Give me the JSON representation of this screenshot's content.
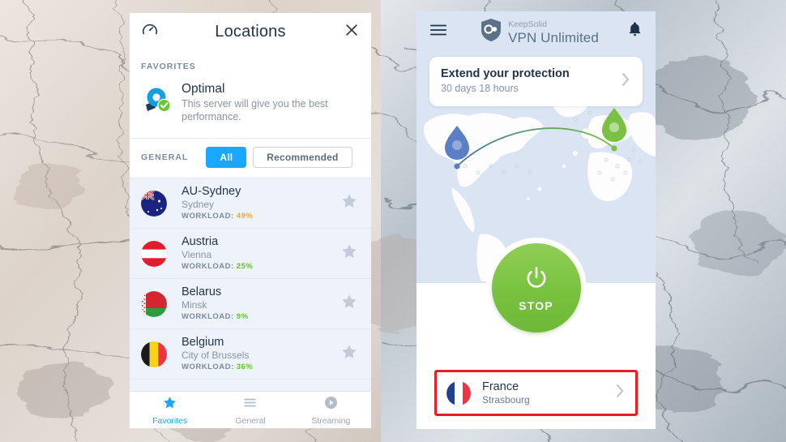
{
  "background": {
    "description": "marble-stone-texture",
    "left_tone": "#ded5cd",
    "right_tone": "#c3cbd3"
  },
  "locations_panel": {
    "header": {
      "gauge_icon": "speedometer-icon",
      "title": "Locations",
      "close_icon": "close-icon"
    },
    "favorites": {
      "label": "FAVORITES",
      "optimal": {
        "icon": "optimal-server-pin-icon",
        "name": "Optimal",
        "description": "This server will give you the best performance."
      }
    },
    "general": {
      "label": "GENERAL",
      "filters": [
        {
          "label": "All",
          "active": true
        },
        {
          "label": "Recommended",
          "active": false
        }
      ]
    },
    "servers": [
      {
        "name": "AU-Sydney",
        "city": "Sydney",
        "workload_label": "WORKLOAD:",
        "workload": "49%",
        "workload_color": "#f0a830",
        "flag": "flag-australia",
        "starred": false
      },
      {
        "name": "Austria",
        "city": "Vienna",
        "workload_label": "WORKLOAD:",
        "workload": "25%",
        "workload_color": "#64c832",
        "flag": "flag-austria",
        "starred": false
      },
      {
        "name": "Belarus",
        "city": "Minsk",
        "workload_label": "WORKLOAD:",
        "workload": "9%",
        "workload_color": "#64c832",
        "flag": "flag-belarus",
        "starred": false
      },
      {
        "name": "Belgium",
        "city": "City of Brussels",
        "workload_label": "WORKLOAD:",
        "workload": "36%",
        "workload_color": "#64c832",
        "flag": "flag-belgium",
        "starred": false
      }
    ],
    "tabs": [
      {
        "label": "Favorites",
        "icon": "star-icon",
        "active": true
      },
      {
        "label": "General",
        "icon": "list-icon",
        "active": false
      },
      {
        "label": "Streaming",
        "icon": "play-circle-icon",
        "active": false
      }
    ]
  },
  "vpn_panel": {
    "header": {
      "menu_icon": "hamburger-menu-icon",
      "logo_icon": "keepsolid-shield-logo-icon",
      "brand_top": "KeepSolid",
      "brand_main": "VPN Unlimited",
      "bell_icon": "notification-bell-icon"
    },
    "extend_card": {
      "title": "Extend your protection",
      "subtitle": "30 days 18 hours",
      "chevron_icon": "chevron-right-icon"
    },
    "map": {
      "origin_pin": "blue-location-pin",
      "destination_pin": "green-location-pin",
      "origin_color": "#5b7fc4",
      "destination_color": "#7ac143"
    },
    "power_button": {
      "label": "STOP",
      "icon": "power-icon",
      "color": "#78c23f"
    },
    "location_selector": {
      "country": "France",
      "city": "Strasbourg",
      "flag": "flag-france",
      "chevron_icon": "chevron-right-icon",
      "highlight_color": "#ec1c24"
    }
  },
  "colors": {
    "accent_blue": "#1aa7ff",
    "green": "#78c23f",
    "dark_text": "#22364a",
    "muted_text": "#8894a4",
    "panel_bg": "#eef2fa"
  }
}
